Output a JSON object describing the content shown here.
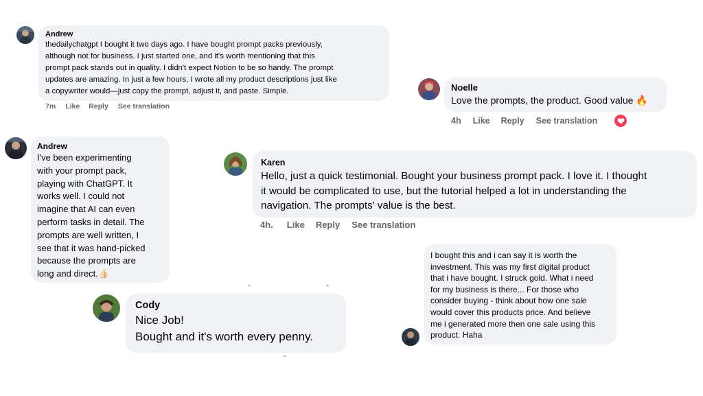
{
  "comments": {
    "andrew1": {
      "name": "Andrew",
      "text": "thedailychatgpt I bought it two days ago. I have bought prompt packs previously,\nalthough not for business. I just started one, and it's worth mentioning that this\nprompt pack stands out in quality. I didn't expect Notion to be so handy. The prompt\nupdates are amazing. In just a few hours, I wrote all my product descriptions just like\na copywriter would—just copy the prompt, adjust it, and paste. Simple.",
      "time": "7m",
      "like": "Like",
      "reply": "Reply",
      "translate": "See translation"
    },
    "noelle": {
      "name": "Noelle",
      "text": "Love the prompts, the product. Good value 🔥",
      "time": "4h",
      "like": "Like",
      "reply": "Reply",
      "translate": "See translation",
      "reaction_icon": "heart-icon",
      "reaction_color": "#f33e58"
    },
    "andrew2": {
      "name": "Andrew",
      "text": "I've been experimenting\nwith your prompt pack,\nplaying with ChatGPT. It\nworks well. I could not\nimagine that AI can even\nperform tasks in detail. The\nprompts are well written, I\nsee that it was hand-picked\nbecause the prompts are\nlong and direct.👍🏻"
    },
    "karen": {
      "name": "Karen",
      "text": "Hello, just a quick testimonial. Bought your business prompt pack. I love it. I thought\nit would be complicated to use, but the tutorial helped a lot in understanding the\nnavigation. The prompts' value is the best.",
      "time": "4h.",
      "like": "Like",
      "reply": "Reply",
      "translate": "See translation"
    },
    "anon": {
      "text": "I bought this and i can say it is worth the\ninvestment. This was my first digital product\nthat i have bought. I struck gold. What i need\nfor my business is there... For those who\nconsider buying - think about how one sale\nwould cover this products price. And believe\nme i generated more then one sale using this\nproduct. Haha"
    },
    "cody": {
      "name": "Cody",
      "text": "Nice Job!\nBought and it's worth every penny."
    }
  },
  "colors": {
    "bubble": "#f0f2f5",
    "meta": "#65676b",
    "text": "#050505"
  }
}
